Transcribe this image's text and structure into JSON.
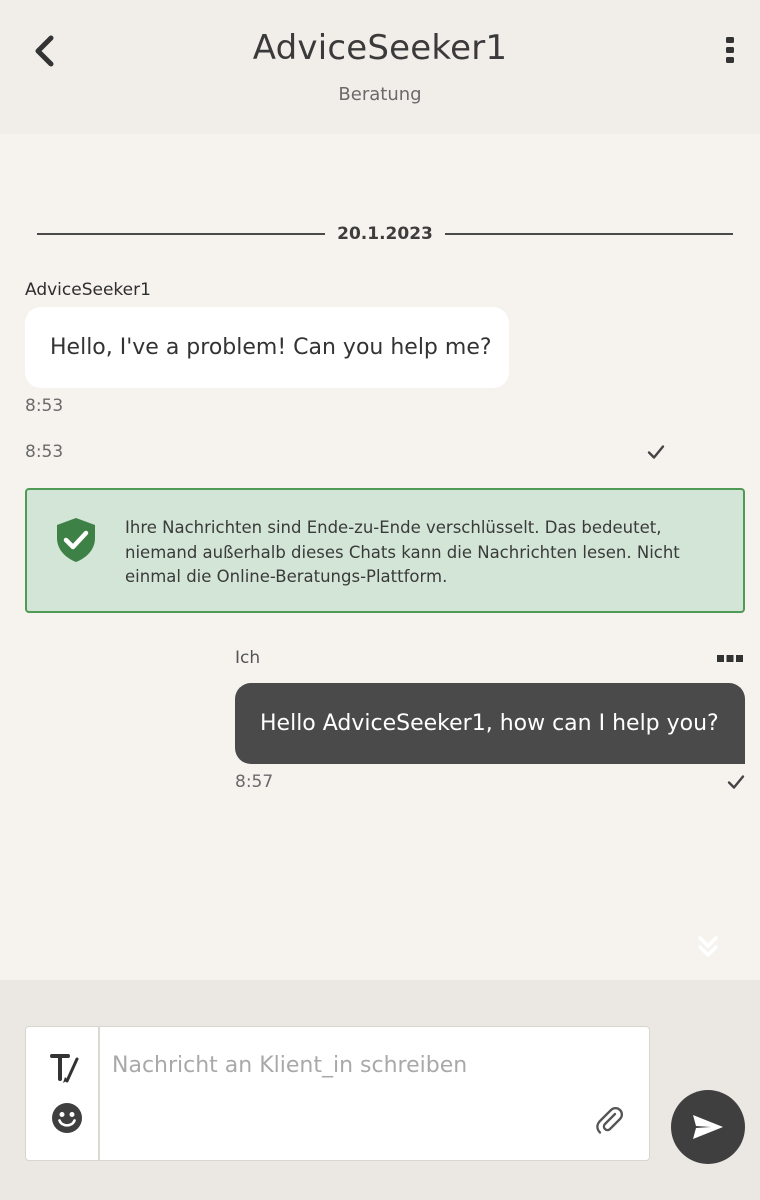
{
  "header": {
    "title": "AdviceSeeker1",
    "subtitle": "Beratung",
    "back_icon": "chevron-left-icon",
    "menu_icon": "kebab-menu-icon"
  },
  "chat": {
    "date_divider": "20.1.2023",
    "incoming": {
      "sender": "AdviceSeeker1",
      "text": "Hello, I've a problem! Can you help me?",
      "time": "8:53"
    },
    "system_time": "8:53",
    "e2e_notice": "Ihre Nachrichten sind Ende-zu-Ende verschlüsselt. Das bedeutet, niemand außerhalb dieses Chats kann die Nachrichten lesen. Nicht einmal die Online-Beratungs-Plattform.",
    "outgoing": {
      "sender": "Ich",
      "text": "Hello AdviceSeeker1, how can I help you?",
      "time": "8:57"
    }
  },
  "composer": {
    "placeholder": "Nachricht an Klient_in schreiben",
    "value": ""
  },
  "colors": {
    "background": "#f6f3ef",
    "header": "#f1eeea",
    "notice_bg": "#d3e5d6",
    "notice_border": "#4f9a55",
    "outgoing_bubble": "#4a4a4a",
    "send_button": "#3f3f3f"
  }
}
